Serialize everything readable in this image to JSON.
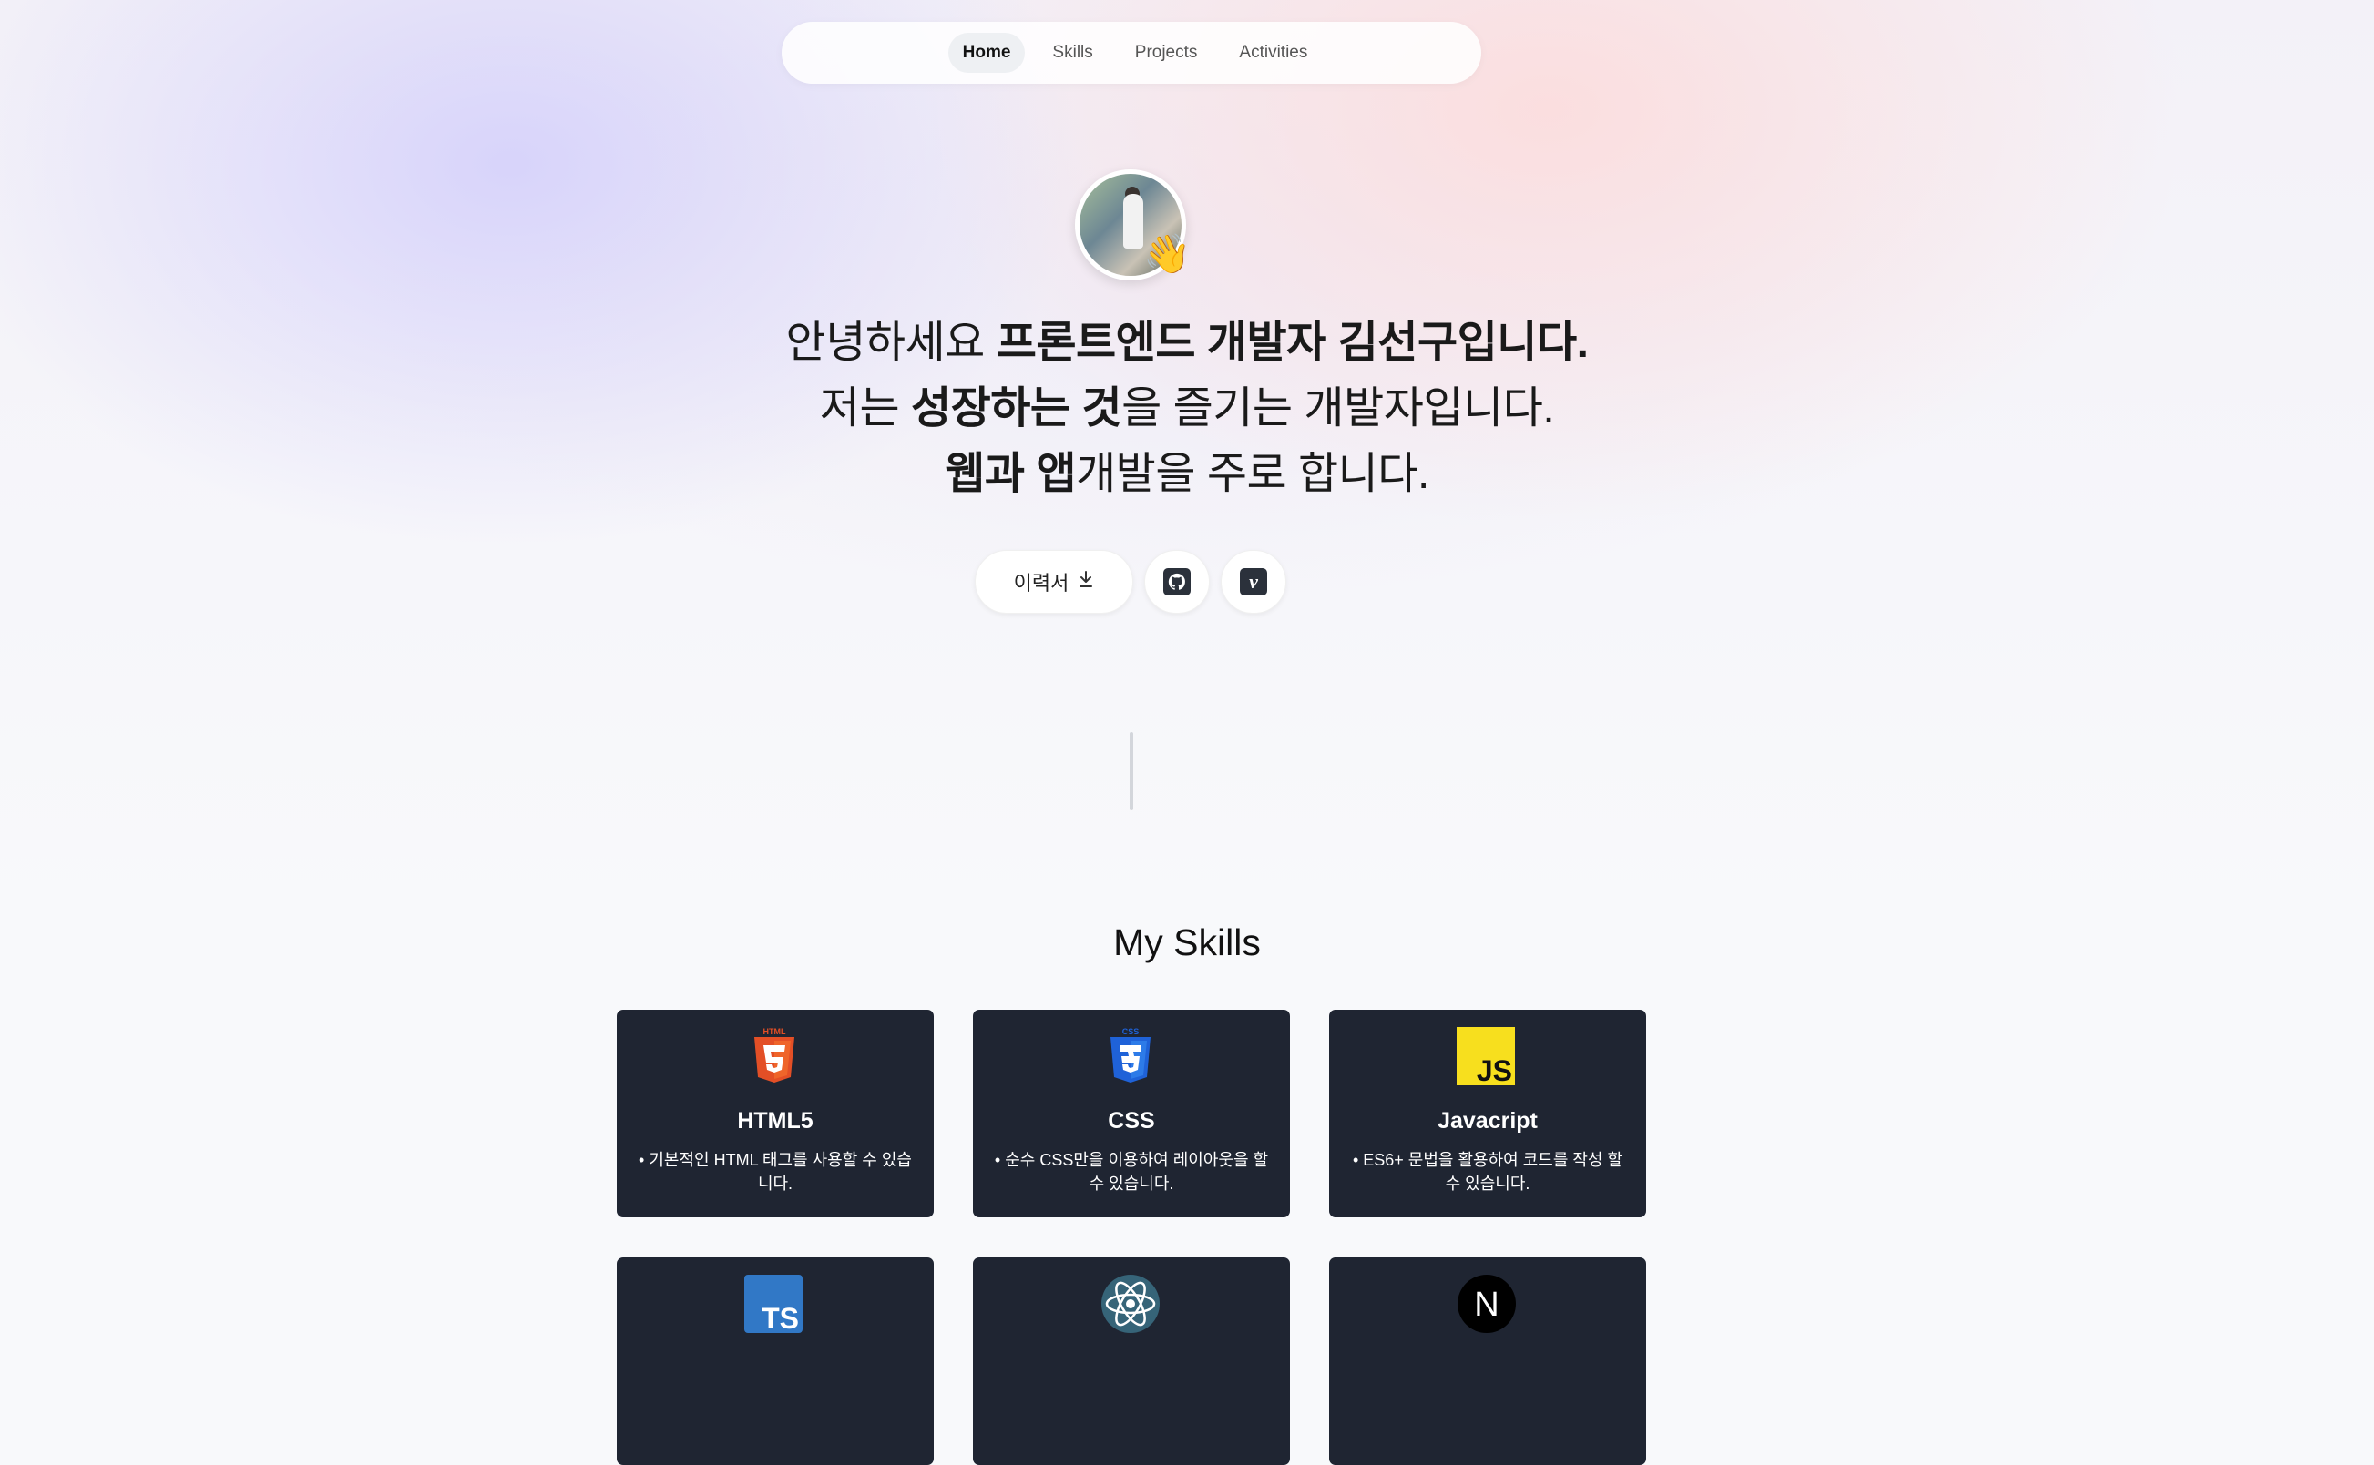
{
  "nav": {
    "items": [
      {
        "label": "Home",
        "active": true
      },
      {
        "label": "Skills",
        "active": false
      },
      {
        "label": "Projects",
        "active": false
      },
      {
        "label": "Activities",
        "active": false
      }
    ]
  },
  "hero": {
    "wave_emoji": "👋",
    "line1": {
      "normal": "안녕하세요 ",
      "bold": "프론트엔드 개발자 김선구입니다."
    },
    "line2": {
      "normal1": "저는 ",
      "bold": "성장하는 것",
      "normal2": "을 즐기는 개발자입니다."
    },
    "line3": {
      "bold": "웹과 앱",
      "normal": "개발을 주로 합니다."
    }
  },
  "buttons": {
    "resume_label": "이력서",
    "resume_icon": "download-icon",
    "github_icon": "github-icon",
    "velog_icon": "velog-icon",
    "velog_glyph": "v"
  },
  "skills": {
    "title": "My Skills",
    "cards": [
      {
        "name": "HTML5",
        "desc": "• 기본적인 HTML 태그를 사용할 수 있습니다.",
        "icon": "html5-icon",
        "logo_text": "HTML"
      },
      {
        "name": "CSS",
        "desc": "• 순수 CSS만을 이용하여 레이아웃을 할 수 있습니다.",
        "icon": "css3-icon",
        "logo_text": "CSS"
      },
      {
        "name": "Javacript",
        "desc": "• ES6+ 문법을 활용하여 코드를 작성 할 수 있습니다.",
        "icon": "javascript-icon",
        "logo_text": "JS"
      },
      {
        "name": "",
        "desc": "",
        "icon": "typescript-icon",
        "logo_text": "TS"
      },
      {
        "name": "",
        "desc": "",
        "icon": "react-icon",
        "logo_text": ""
      },
      {
        "name": "",
        "desc": "",
        "icon": "nextjs-icon",
        "logo_text": "N"
      }
    ]
  },
  "colors": {
    "card_bg": "#1f2532",
    "html_orange": "#e34f26",
    "css_blue": "#1f62d8",
    "js_yellow": "#f7df1e",
    "ts_blue": "#3178c6",
    "react_cyan": "#61dafb"
  }
}
